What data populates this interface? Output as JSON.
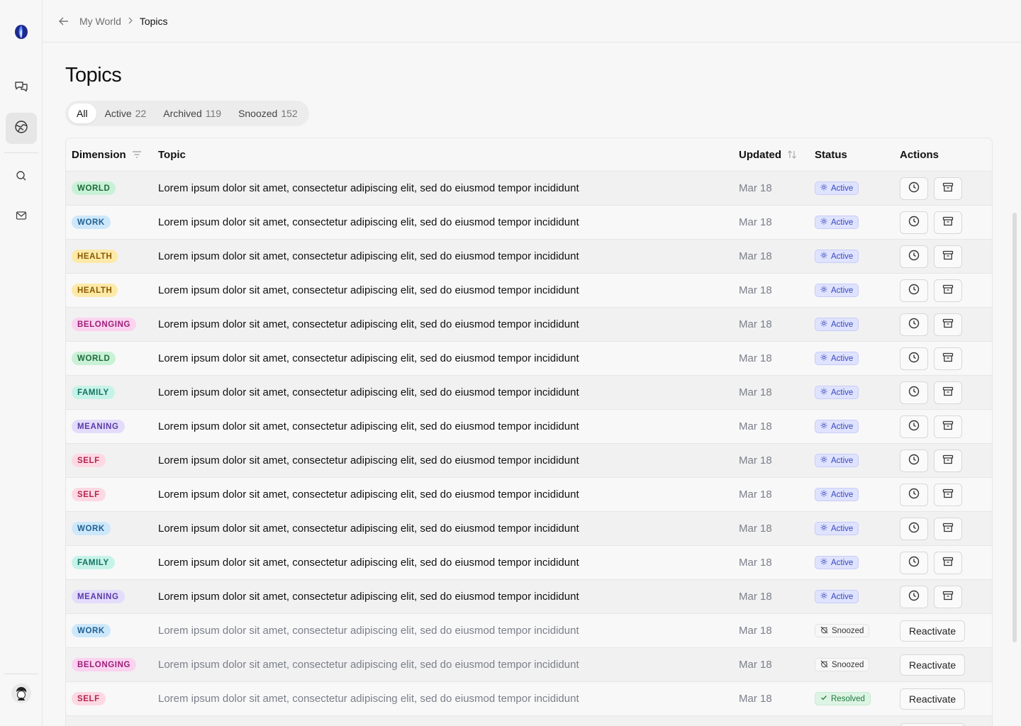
{
  "breadcrumb": {
    "parent": "My World",
    "current": "Topics"
  },
  "page": {
    "title": "Topics"
  },
  "tabs": [
    {
      "label": "All",
      "count": ""
    },
    {
      "label": "Active",
      "count": "22"
    },
    {
      "label": "Archived",
      "count": "119"
    },
    {
      "label": "Snoozed",
      "count": "152"
    }
  ],
  "table": {
    "headers": {
      "dimension": "Dimension",
      "topic": "Topic",
      "updated": "Updated",
      "status": "Status",
      "actions": "Actions"
    },
    "action_label": "Reactivate",
    "rows": [
      {
        "dimension": "WORLD",
        "topic": "Lorem ipsum dolor sit amet, consectetur adipiscing elit, sed do eiusmod tempor incididunt",
        "updated": "Mar 18",
        "status": "Active"
      },
      {
        "dimension": "WORK",
        "topic": "Lorem ipsum dolor sit amet, consectetur adipiscing elit, sed do eiusmod tempor incididunt",
        "updated": "Mar 18",
        "status": "Active"
      },
      {
        "dimension": "HEALTH",
        "topic": "Lorem ipsum dolor sit amet, consectetur adipiscing elit, sed do eiusmod tempor incididunt",
        "updated": "Mar 18",
        "status": "Active"
      },
      {
        "dimension": "HEALTH",
        "topic": "Lorem ipsum dolor sit amet, consectetur adipiscing elit, sed do eiusmod tempor incididunt",
        "updated": "Mar 18",
        "status": "Active"
      },
      {
        "dimension": "BELONGING",
        "topic": "Lorem ipsum dolor sit amet, consectetur adipiscing elit, sed do eiusmod tempor incididunt",
        "updated": "Mar 18",
        "status": "Active"
      },
      {
        "dimension": "WORLD",
        "topic": "Lorem ipsum dolor sit amet, consectetur adipiscing elit, sed do eiusmod tempor incididunt",
        "updated": "Mar 18",
        "status": "Active"
      },
      {
        "dimension": "FAMILY",
        "topic": "Lorem ipsum dolor sit amet, consectetur adipiscing elit, sed do eiusmod tempor incididunt",
        "updated": "Mar 18",
        "status": "Active"
      },
      {
        "dimension": "MEANING",
        "topic": "Lorem ipsum dolor sit amet, consectetur adipiscing elit, sed do eiusmod tempor incididunt",
        "updated": "Mar 18",
        "status": "Active"
      },
      {
        "dimension": "SELF",
        "topic": "Lorem ipsum dolor sit amet, consectetur adipiscing elit, sed do eiusmod tempor incididunt",
        "updated": "Mar 18",
        "status": "Active"
      },
      {
        "dimension": "SELF",
        "topic": "Lorem ipsum dolor sit amet, consectetur adipiscing elit, sed do eiusmod tempor incididunt",
        "updated": "Mar 18",
        "status": "Active"
      },
      {
        "dimension": "WORK",
        "topic": "Lorem ipsum dolor sit amet, consectetur adipiscing elit, sed do eiusmod tempor incididunt",
        "updated": "Mar 18",
        "status": "Active"
      },
      {
        "dimension": "FAMILY",
        "topic": "Lorem ipsum dolor sit amet, consectetur adipiscing elit, sed do eiusmod tempor incididunt",
        "updated": "Mar 18",
        "status": "Active"
      },
      {
        "dimension": "MEANING",
        "topic": "Lorem ipsum dolor sit amet, consectetur adipiscing elit, sed do eiusmod tempor incididunt",
        "updated": "Mar 18",
        "status": "Active"
      },
      {
        "dimension": "WORK",
        "topic": "Lorem ipsum dolor sit amet, consectetur adipiscing elit, sed do eiusmod tempor incididunt",
        "updated": "Mar 18",
        "status": "Snoozed"
      },
      {
        "dimension": "BELONGING",
        "topic": "Lorem ipsum dolor sit amet, consectetur adipiscing elit, sed do eiusmod tempor incididunt",
        "updated": "Mar 18",
        "status": "Snoozed"
      },
      {
        "dimension": "SELF",
        "topic": "Lorem ipsum dolor sit amet, consectetur adipiscing elit, sed do eiusmod tempor incididunt",
        "updated": "Mar 18",
        "status": "Resolved"
      }
    ]
  },
  "colors": {
    "WORLD": {
      "bg": "#c9f1d6",
      "fg": "#1d6b3a"
    },
    "WORK": {
      "bg": "#cde8fb",
      "fg": "#1f5f8f"
    },
    "HEALTH": {
      "bg": "#fde9a8",
      "fg": "#8a5a00"
    },
    "BELONGING": {
      "bg": "#fbd3f0",
      "fg": "#9b1f78"
    },
    "FAMILY": {
      "bg": "#c6f3e8",
      "fg": "#137061"
    },
    "MEANING": {
      "bg": "#e4dcfb",
      "fg": "#5a3aa8"
    },
    "SELF": {
      "bg": "#fdd9e3",
      "fg": "#b0254f"
    }
  }
}
